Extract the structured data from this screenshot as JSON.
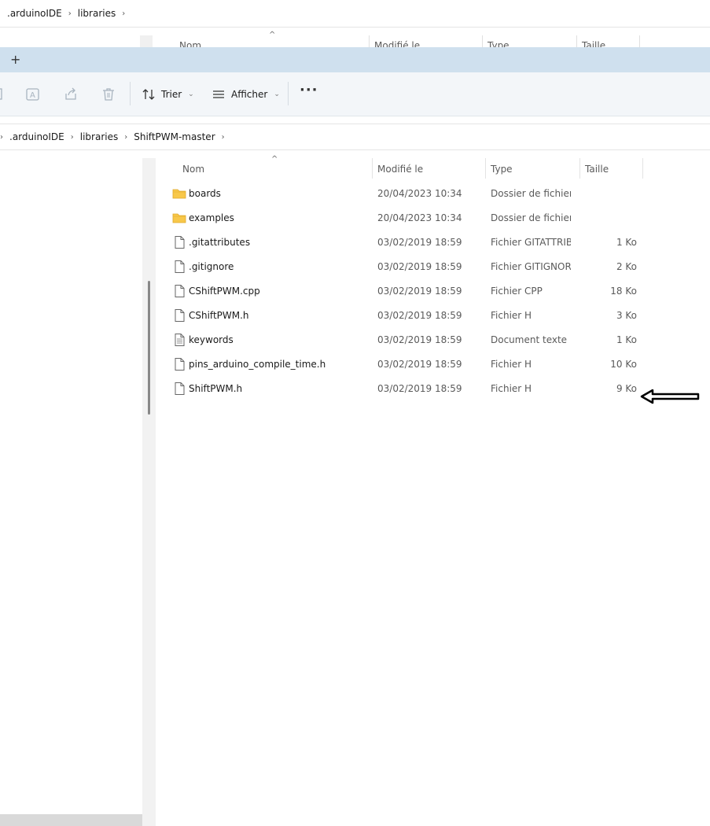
{
  "background_window": {
    "breadcrumb": [
      ".arduinoIDE",
      "libraries"
    ],
    "columns": [
      "Nom",
      "Modifié le",
      "Type",
      "Taille"
    ]
  },
  "tabbar": {
    "new_tab_label": "+"
  },
  "toolbar": {
    "sort_label": "Trier",
    "view_label": "Afficher",
    "more_label": "···"
  },
  "address": {
    "breadcrumb": [
      ".arduinoIDE",
      "libraries",
      "ShiftPWM-master"
    ]
  },
  "list": {
    "columns": {
      "name": "Nom",
      "modified": "Modifié le",
      "type": "Type",
      "size": "Taille"
    },
    "files": [
      {
        "name": "boards",
        "modified": "20/04/2023 10:34",
        "type": "Dossier de fichiers",
        "size": "",
        "icon": "folder-icon"
      },
      {
        "name": "examples",
        "modified": "20/04/2023 10:34",
        "type": "Dossier de fichiers",
        "size": "",
        "icon": "folder-icon"
      },
      {
        "name": ".gitattributes",
        "modified": "03/02/2019 18:59",
        "type": "Fichier GITATTRIB...",
        "size": "1 Ko",
        "icon": "file-icon"
      },
      {
        "name": ".gitignore",
        "modified": "03/02/2019 18:59",
        "type": "Fichier GITIGNORE",
        "size": "2 Ko",
        "icon": "file-icon"
      },
      {
        "name": "CShiftPWM.cpp",
        "modified": "03/02/2019 18:59",
        "type": "Fichier CPP",
        "size": "18 Ko",
        "icon": "file-icon"
      },
      {
        "name": "CShiftPWM.h",
        "modified": "03/02/2019 18:59",
        "type": "Fichier H",
        "size": "3 Ko",
        "icon": "file-icon"
      },
      {
        "name": "keywords",
        "modified": "03/02/2019 18:59",
        "type": "Document texte",
        "size": "1 Ko",
        "icon": "text-document-icon"
      },
      {
        "name": "pins_arduino_compile_time.h",
        "modified": "03/02/2019 18:59",
        "type": "Fichier H",
        "size": "10 Ko",
        "icon": "file-icon"
      },
      {
        "name": "ShiftPWM.h",
        "modified": "03/02/2019 18:59",
        "type": "Fichier H",
        "size": "9 Ko",
        "icon": "file-icon"
      }
    ]
  },
  "colors": {
    "tabbar_bg": "#cfe0ee",
    "toolbar_bg": "#f3f6f9",
    "folder_yellow": "#f8c84a",
    "annotation_arrow": "#000000"
  }
}
